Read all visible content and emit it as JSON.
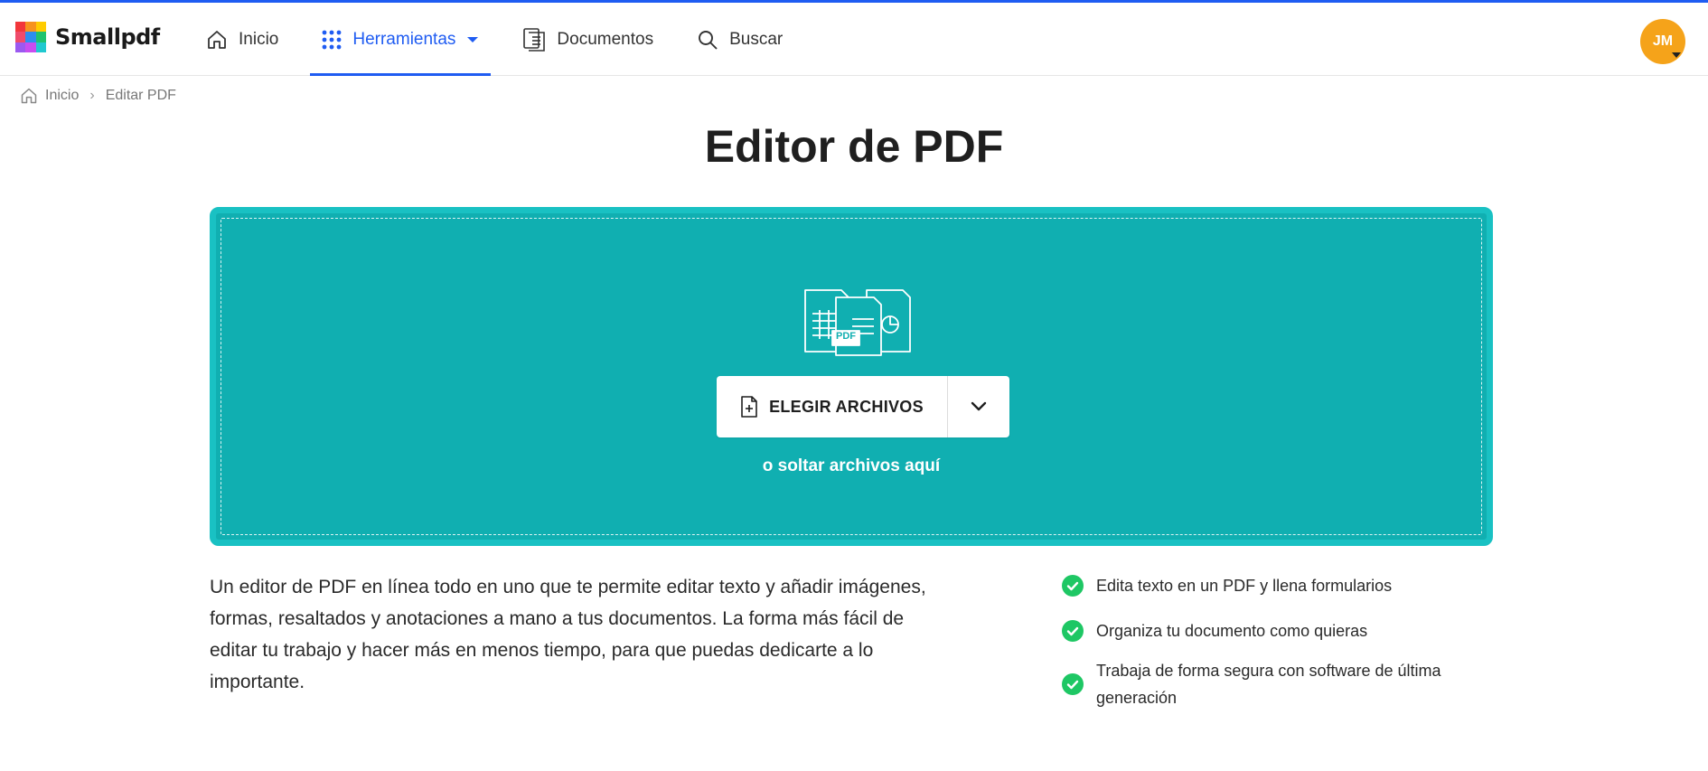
{
  "brand": {
    "name": "Smallpdf",
    "logo_colors": [
      "#f2373b",
      "#f7931e",
      "#ffcc00",
      "#ef4b6b",
      "#2b8ef0",
      "#1fc36f",
      "#9b59f0",
      "#c84df0",
      "#20c9d0"
    ]
  },
  "nav": {
    "items": [
      {
        "label": "Inicio",
        "icon": "home-icon"
      },
      {
        "label": "Herramientas",
        "icon": "grid-icon",
        "active": true,
        "dropdown": true
      },
      {
        "label": "Documentos",
        "icon": "documents-icon"
      },
      {
        "label": "Buscar",
        "icon": "search-icon"
      }
    ]
  },
  "user": {
    "initials": "JM",
    "avatar_color": "#f5a31a"
  },
  "breadcrumb": {
    "home": "Inicio",
    "separator": "›",
    "current": "Editar PDF"
  },
  "page": {
    "title": "Editor de PDF"
  },
  "dropzone": {
    "choose_label": "ELEGIR ARCHIVOS",
    "hint": "o soltar archivos aquí",
    "illustration_badge": "PDF",
    "bg_color": "#10afb1"
  },
  "description": "Un editor de PDF en línea todo en uno que te permite editar texto y añadir imágenes, formas, resaltados y anotaciones a mano a tus documentos. La forma más fácil de editar tu trabajo y hacer más en menos tiempo, para que puedas dedicarte a lo importante.",
  "features": [
    "Edita texto en un PDF y llena formularios",
    "Organiza tu documento como quieras",
    "Trabaja de forma segura con software de última generación"
  ],
  "colors": {
    "accent": "#1f5cf2",
    "check": "#1ec764"
  }
}
